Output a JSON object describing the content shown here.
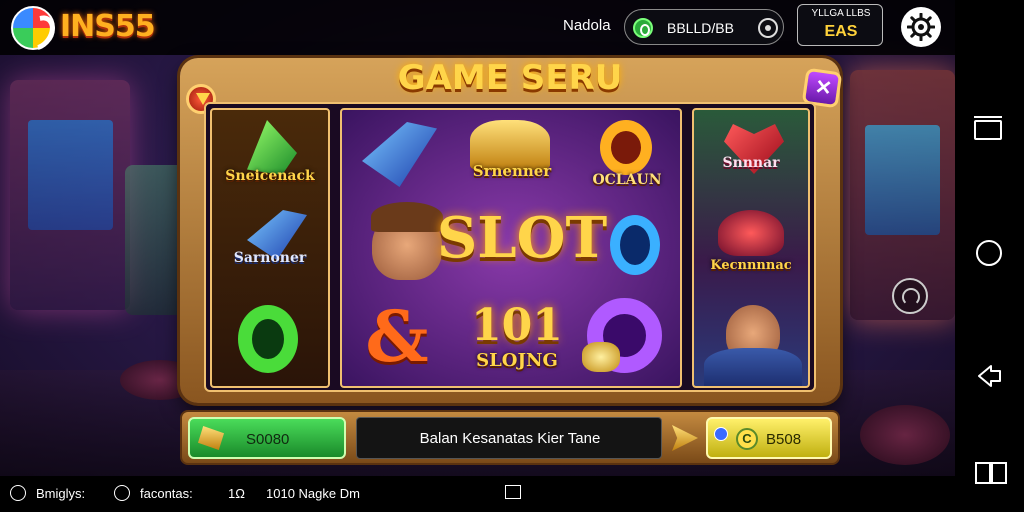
{
  "header": {
    "brand": "INS55",
    "label": "Nadola",
    "balance": "BBLLD/BB",
    "jackpot_top": "YLLGA LLBS",
    "jackpot_value": "EAS"
  },
  "game": {
    "title": "GAME SERU",
    "reel_left": [
      "Sneicenack",
      "Sarnoner"
    ],
    "reel_center": {
      "crown_label": "Srnenner",
      "oclaun": "OCLAUN",
      "slot": "SLOT",
      "number": "101",
      "slojing": "SLOJNG"
    },
    "reel_right": [
      "Snnnar",
      "Kecnnnnac"
    ]
  },
  "controls": {
    "left_button": "S0080",
    "message": "Balan Kesanatas Kier Tane",
    "right_button": "B508"
  },
  "statusbar": {
    "item1": "Bmiglys:",
    "item2": "facontas:",
    "item3": "1010 Nagke Dm",
    "item3_prefix": "1Ω"
  },
  "colors": {
    "brand": "#ffb020",
    "title_gold": "#ffd54a",
    "green_button": "#2aaa3a",
    "yellow_button": "#f0e040"
  }
}
